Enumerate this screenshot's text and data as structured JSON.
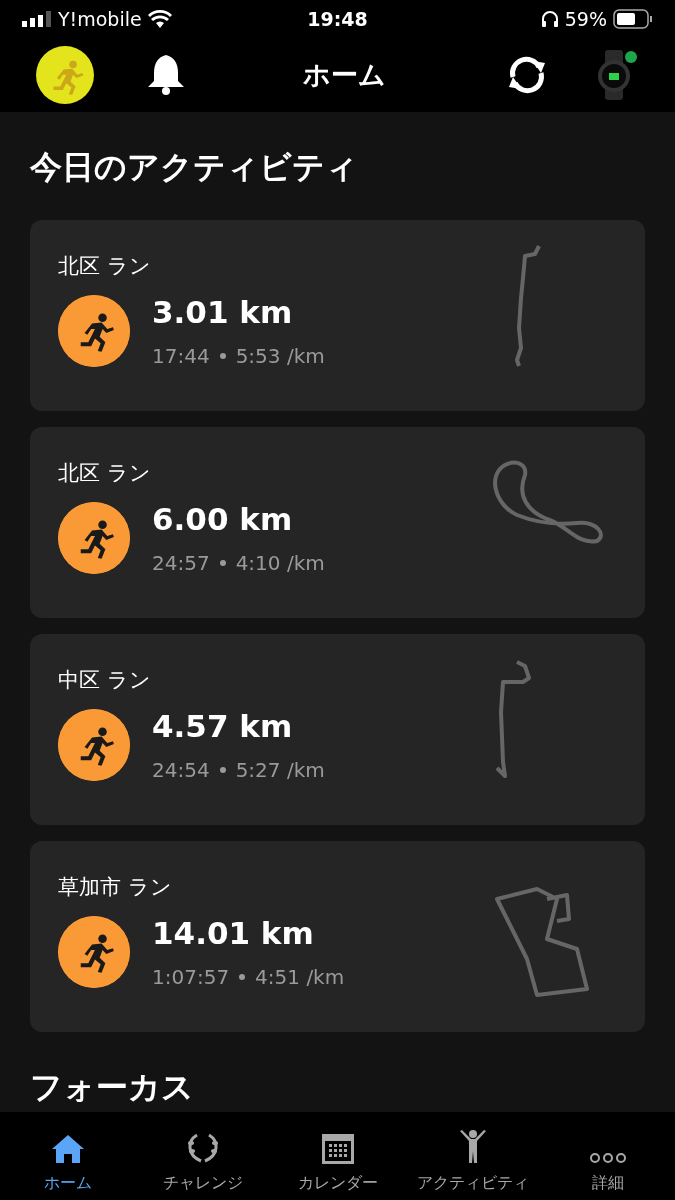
{
  "status_bar": {
    "carrier": "Y!mobile",
    "time": "19:48",
    "battery": "59%"
  },
  "header": {
    "title": "ホーム",
    "watch_connected": true
  },
  "section_title": "今日のアクティビティ",
  "activities": [
    {
      "name": "北区 ラン",
      "distance": "3.01 km",
      "duration": "17:44",
      "pace": "5:53 /km"
    },
    {
      "name": "北区 ラン",
      "distance": "6.00 km",
      "duration": "24:57",
      "pace": "4:10 /km"
    },
    {
      "name": "中区 ラン",
      "distance": "4.57 km",
      "duration": "24:54",
      "pace": "5:27 /km"
    },
    {
      "name": "草加市 ラン",
      "distance": "14.01 km",
      "duration": "1:07:57",
      "pace": "4:51 /km"
    }
  ],
  "next_section_title": "フォーカス",
  "tabs": [
    {
      "label": "ホーム",
      "kind": "home",
      "selected": true
    },
    {
      "label": "チャレンジ",
      "kind": "challenge",
      "selected": false
    },
    {
      "label": "カレンダー",
      "kind": "calendar",
      "selected": false
    },
    {
      "label": "アクティビティ",
      "kind": "activity",
      "selected": false
    },
    {
      "label": "詳細",
      "kind": "more",
      "selected": false
    }
  ]
}
